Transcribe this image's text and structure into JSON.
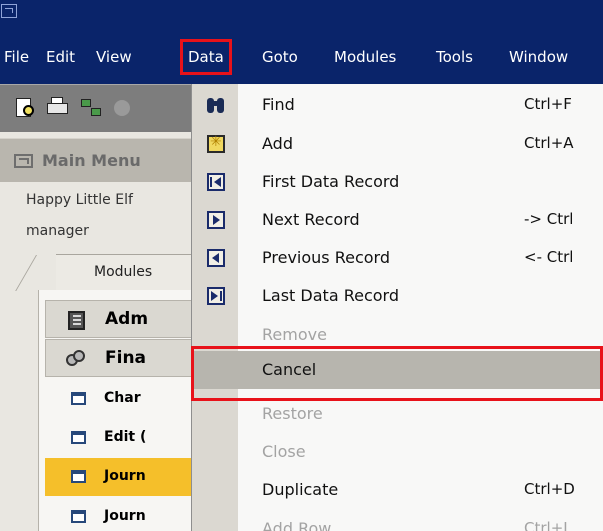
{
  "menubar": {
    "items": [
      {
        "label": "File",
        "accel": "F"
      },
      {
        "label": "Edit",
        "accel": "E"
      },
      {
        "label": "View",
        "accel": "V"
      },
      {
        "label": "Data",
        "accel": "D"
      },
      {
        "label": "Goto",
        "accel": "G"
      },
      {
        "label": "Modules",
        "accel": "M"
      },
      {
        "label": "Tools",
        "accel": "T"
      },
      {
        "label": "Window",
        "accel": "W"
      }
    ],
    "selected": "Data"
  },
  "toolbar": {
    "icons": [
      "print-preview-icon",
      "print-icon",
      "network-icon",
      "settings-icon"
    ]
  },
  "left_panel": {
    "header": "Main Menu",
    "user_name": "Happy Little Elf",
    "user_role": "manager",
    "tab_label": "Modules",
    "modules": [
      {
        "label": "Adm",
        "icon": "book-icon",
        "kind": "group"
      },
      {
        "label": "Fina",
        "icon": "coins-icon",
        "kind": "group"
      },
      {
        "label": "Char",
        "icon": "window-icon",
        "kind": "sub"
      },
      {
        "label": "Edit (",
        "icon": "window-icon",
        "kind": "sub"
      },
      {
        "label": "Journ",
        "icon": "window-icon",
        "kind": "sub",
        "highlighted": true
      },
      {
        "label": "Journ",
        "icon": "window-icon",
        "kind": "sub"
      }
    ]
  },
  "dropdown": {
    "items": [
      {
        "label": "Find",
        "shortcut": "Ctrl+F",
        "icon": "binoculars-icon",
        "enabled": true
      },
      {
        "label": "Add",
        "shortcut": "Ctrl+A",
        "icon": "add-record-icon",
        "enabled": true
      },
      {
        "label": "First Data Record",
        "shortcut": "",
        "icon": "first-record-icon",
        "enabled": true
      },
      {
        "label": "Next Record",
        "shortcut": "-> Ctrl",
        "icon": "next-record-icon",
        "enabled": true
      },
      {
        "label": "Previous Record",
        "shortcut": "<- Ctrl",
        "icon": "previous-record-icon",
        "enabled": true
      },
      {
        "label": "Last Data Record",
        "shortcut": "",
        "icon": "last-record-icon",
        "enabled": true
      },
      {
        "label": "Remove",
        "shortcut": "",
        "icon": "",
        "enabled": false
      },
      {
        "label": "Cancel",
        "shortcut": "",
        "icon": "",
        "enabled": true,
        "selected": true
      },
      {
        "label": "Restore",
        "shortcut": "",
        "icon": "",
        "enabled": false
      },
      {
        "label": "Close",
        "shortcut": "",
        "icon": "",
        "enabled": false
      },
      {
        "label": "Duplicate",
        "shortcut": "Ctrl+D",
        "icon": "",
        "enabled": true
      },
      {
        "label": "Add Row",
        "shortcut": "Ctrl+I",
        "icon": "",
        "enabled": false
      }
    ]
  },
  "colors": {
    "menubar_bg": "#0a246a",
    "annotation_red": "#e8121a",
    "highlight_row": "#f5bf2a",
    "selected_item": "#b7b5ae"
  }
}
